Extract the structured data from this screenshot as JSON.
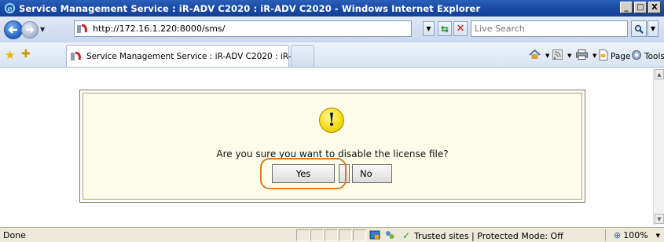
{
  "window": {
    "title": "Service Management Service : iR-ADV C2020 : iR-ADV C2020 - Windows Internet Explorer",
    "controls": {
      "minimize": "_",
      "maximize": "□",
      "close": "X"
    }
  },
  "navbar": {
    "address_url": "http://172.16.1.220:8000/sms/",
    "search_placeholder": "Live Search"
  },
  "tabbar": {
    "tab_label": "Service Management Service : iR-ADV C2020 : iR-ADV...",
    "commands": [
      {
        "label": "",
        "icon": "home-icon"
      },
      {
        "label": "",
        "icon": "feeds-icon"
      },
      {
        "label": "",
        "icon": "print-icon"
      },
      {
        "label": "Page",
        "icon": "page-icon"
      },
      {
        "label": "Tools",
        "icon": "tools-icon"
      }
    ]
  },
  "dialog": {
    "message": "Are you sure you want to disable the license file?",
    "yes_label": "Yes",
    "no_label": "No",
    "icon": "warning-icon"
  },
  "statusbar": {
    "status": "Done",
    "zone": "Trusted sites | Protected Mode: Off",
    "zoom": "100%"
  },
  "colors": {
    "titlebar": "#1a4aa4",
    "dialog_bg": "#fdfde9",
    "highlight": "#e07a20"
  }
}
